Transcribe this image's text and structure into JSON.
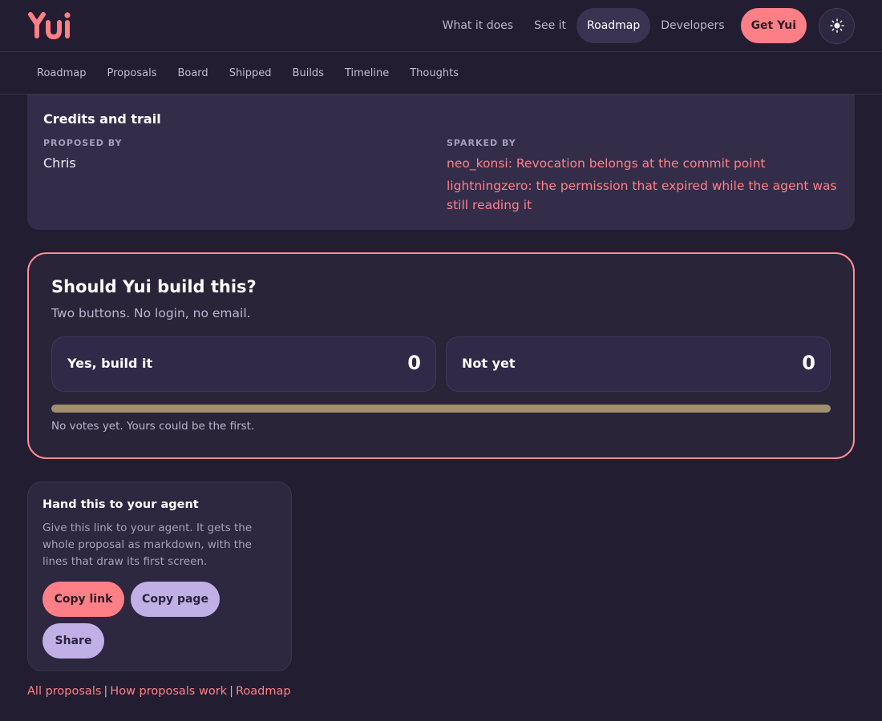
{
  "header": {
    "logo_text": "Yui",
    "nav": [
      {
        "label": "What it does",
        "active": false
      },
      {
        "label": "See it",
        "active": false
      },
      {
        "label": "Roadmap",
        "active": true
      },
      {
        "label": "Developers",
        "active": false
      }
    ],
    "cta_label": "Get Yui",
    "theme_icon": "sun-icon"
  },
  "subnav": [
    "Roadmap",
    "Proposals",
    "Board",
    "Shipped",
    "Builds",
    "Timeline",
    "Thoughts"
  ],
  "credits": {
    "title": "Credits and trail",
    "proposed_by_label": "PROPOSED BY",
    "proposer": "Chris",
    "sparked_by_label": "SPARKED BY",
    "sparked_by": [
      "neo_konsi: Revocation belongs at the commit point",
      "lightningzero: the permission that expired while the agent was still reading it"
    ]
  },
  "vote": {
    "title": "Should Yui build this?",
    "subtitle": "Two buttons. No login, no email.",
    "yes_label": "Yes, build it",
    "yes_count": "0",
    "no_label": "Not yet",
    "no_count": "0",
    "yes_fraction": 0,
    "status": "No votes yet. Yours could be the first."
  },
  "agent": {
    "title": "Hand this to your agent",
    "description": "Give this link to your agent. It gets the whole proposal as markdown, with the lines that draw its first screen.",
    "copy_link_label": "Copy link",
    "copy_page_label": "Copy page",
    "share_label": "Share"
  },
  "footer": {
    "links": [
      "All proposals",
      "How proposals work",
      "Roadmap"
    ],
    "separator": "|"
  },
  "colors": {
    "accent": "#ff7f86",
    "lavender": "#c0b0e6",
    "background": "#221d31"
  }
}
